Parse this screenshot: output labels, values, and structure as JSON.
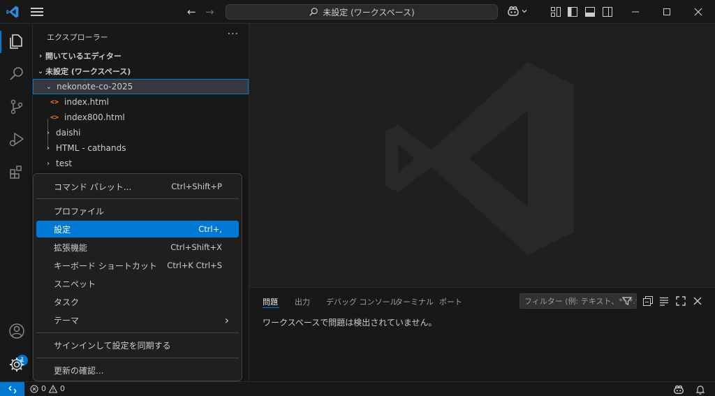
{
  "titlebar": {
    "search_text": "未設定 (ワークスペース)"
  },
  "activity": {
    "accounts_badge": "1"
  },
  "sidebar": {
    "title": "エクスプローラー",
    "more": "···",
    "open_editors": "開いているエディター",
    "workspace": "未設定 (ワークスペース)",
    "tree": {
      "folder_open": "nekonote-co-2025",
      "files": [
        "index.html",
        "index800.html"
      ],
      "folders": [
        "daishi",
        "HTML - cathands",
        "test"
      ]
    }
  },
  "menu": {
    "command_palette": {
      "label": "コマンド パレット...",
      "kb": "Ctrl+Shift+P"
    },
    "profile": {
      "label": "プロファイル"
    },
    "settings": {
      "label": "設定",
      "kb": "Ctrl+,"
    },
    "extensions": {
      "label": "拡張機能",
      "kb": "Ctrl+Shift+X"
    },
    "keyboard_shortcuts": {
      "label": "キーボード ショートカット",
      "kb": "Ctrl+K Ctrl+S"
    },
    "snippets": {
      "label": "スニペット"
    },
    "tasks": {
      "label": "タスク"
    },
    "themes": {
      "label": "テーマ",
      "arrow": "›"
    },
    "sync": {
      "label": "サインインして設定を同期する"
    },
    "updates": {
      "label": "更新の確認..."
    }
  },
  "panel": {
    "tabs": [
      "問題",
      "出力",
      "デバッグ コンソール",
      "ターミナル",
      "ポート"
    ],
    "filter_placeholder": "フィルター (例: テキスト、**/*.ts、!**/node_modules/**)",
    "message": "ワークスペースで問題は検出されていません。"
  },
  "status": {
    "errors": "0",
    "warnings": "0"
  },
  "colors": {
    "accent": "#0078d4",
    "background": "#1f1f1f",
    "chrome": "#181818"
  }
}
